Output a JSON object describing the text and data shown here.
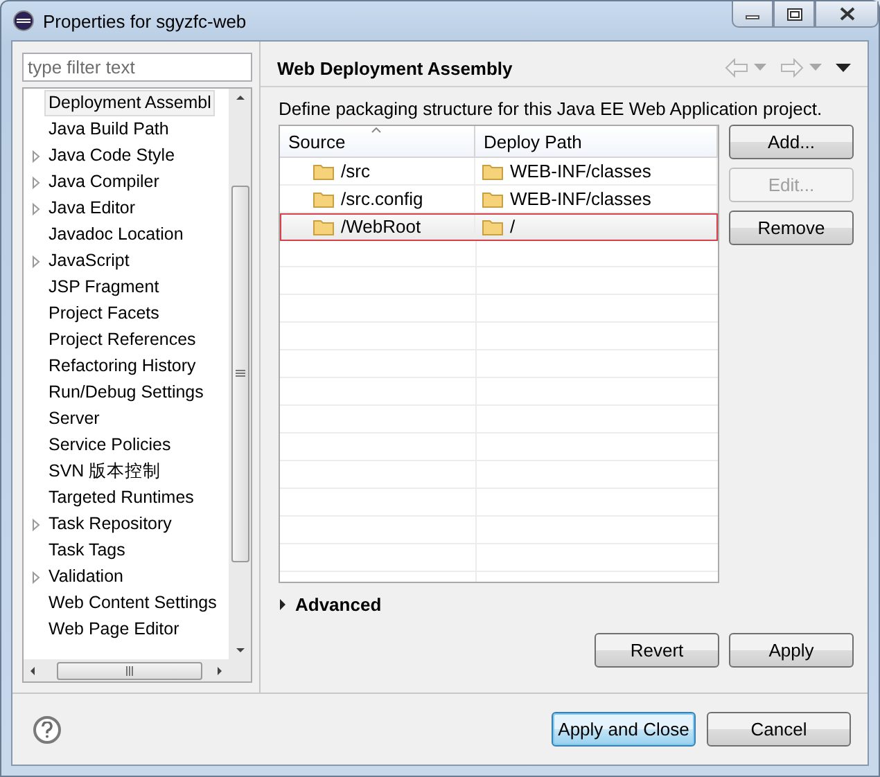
{
  "window": {
    "title": "Properties for sgyzfc-web"
  },
  "filter": {
    "placeholder": "type filter text"
  },
  "tree": {
    "items": [
      {
        "label": "Deployment Assembl",
        "expandable": false,
        "selected": true
      },
      {
        "label": "Java Build Path",
        "expandable": false,
        "selected": false
      },
      {
        "label": "Java Code Style",
        "expandable": true,
        "selected": false
      },
      {
        "label": "Java Compiler",
        "expandable": true,
        "selected": false
      },
      {
        "label": "Java Editor",
        "expandable": true,
        "selected": false
      },
      {
        "label": "Javadoc Location",
        "expandable": false,
        "selected": false
      },
      {
        "label": "JavaScript",
        "expandable": true,
        "selected": false
      },
      {
        "label": "JSP Fragment",
        "expandable": false,
        "selected": false
      },
      {
        "label": "Project Facets",
        "expandable": false,
        "selected": false
      },
      {
        "label": "Project References",
        "expandable": false,
        "selected": false
      },
      {
        "label": "Refactoring History",
        "expandable": false,
        "selected": false
      },
      {
        "label": "Run/Debug Settings",
        "expandable": false,
        "selected": false
      },
      {
        "label": "Server",
        "expandable": false,
        "selected": false
      },
      {
        "label": "Service Policies",
        "expandable": false,
        "selected": false
      },
      {
        "label": "SVN 版本控制",
        "expandable": false,
        "selected": false
      },
      {
        "label": "Targeted Runtimes",
        "expandable": false,
        "selected": false
      },
      {
        "label": "Task Repository",
        "expandable": true,
        "selected": false
      },
      {
        "label": "Task Tags",
        "expandable": false,
        "selected": false
      },
      {
        "label": "Validation",
        "expandable": true,
        "selected": false
      },
      {
        "label": "Web Content Settings",
        "expandable": false,
        "selected": false
      },
      {
        "label": "Web Page Editor",
        "expandable": false,
        "selected": false
      }
    ]
  },
  "page": {
    "title": "Web Deployment Assembly",
    "description": "Define packaging structure for this Java EE Web Application project.",
    "table": {
      "columns": [
        "Source",
        "Deploy Path"
      ],
      "rows": [
        {
          "source": "/src",
          "deploy_path": "WEB-INF/classes",
          "highlighted": false
        },
        {
          "source": "/src.config",
          "deploy_path": "WEB-INF/classes",
          "highlighted": false
        },
        {
          "source": "/WebRoot",
          "deploy_path": "/",
          "highlighted": true
        }
      ]
    },
    "side_buttons": [
      {
        "label": "Add...",
        "disabled": false
      },
      {
        "label": "Edit...",
        "disabled": true
      },
      {
        "label": "Remove",
        "disabled": false
      }
    ],
    "advanced": {
      "label": "Advanced",
      "expanded": false
    },
    "page_buttons": [
      "Revert",
      "Apply"
    ]
  },
  "dialog_buttons": [
    {
      "label": "Apply and Close",
      "default": true
    },
    {
      "label": "Cancel",
      "default": false
    }
  ]
}
